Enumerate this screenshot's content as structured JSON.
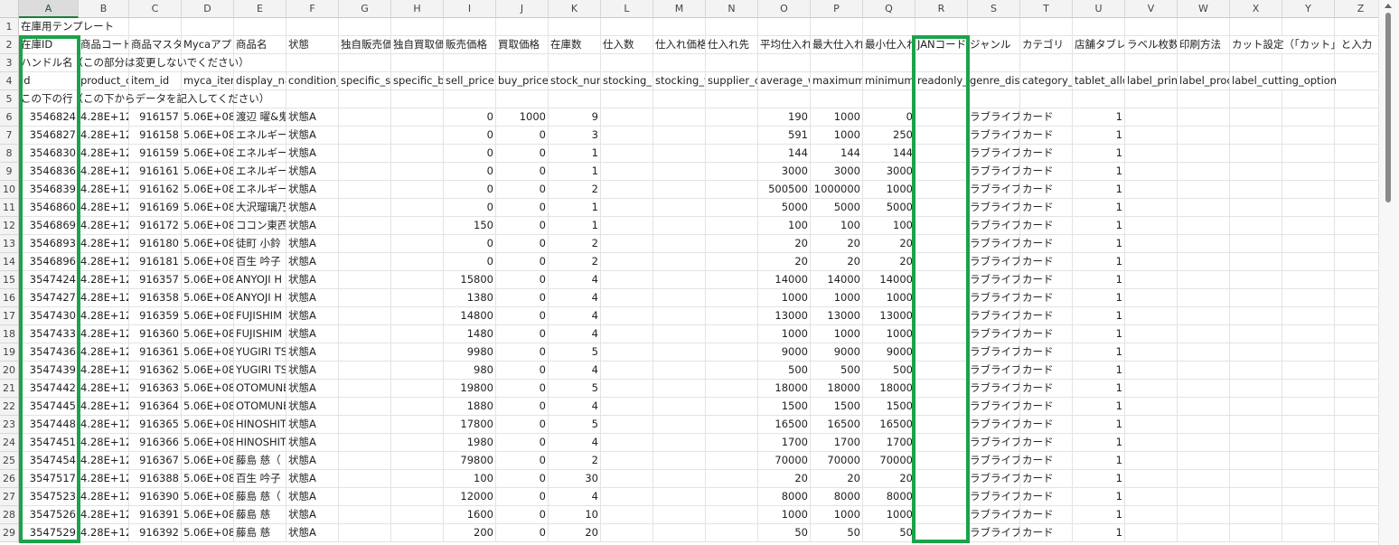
{
  "columns": [
    {
      "letter": "A",
      "w": 66
    },
    {
      "letter": "B",
      "w": 56
    },
    {
      "letter": "C",
      "w": 58
    },
    {
      "letter": "D",
      "w": 58
    },
    {
      "letter": "E",
      "w": 58
    },
    {
      "letter": "F",
      "w": 58
    },
    {
      "letter": "G",
      "w": 58
    },
    {
      "letter": "H",
      "w": 58
    },
    {
      "letter": "I",
      "w": 58
    },
    {
      "letter": "J",
      "w": 58
    },
    {
      "letter": "K",
      "w": 58
    },
    {
      "letter": "L",
      "w": 58
    },
    {
      "letter": "M",
      "w": 58
    },
    {
      "letter": "N",
      "w": 58
    },
    {
      "letter": "O",
      "w": 58
    },
    {
      "letter": "P",
      "w": 58
    },
    {
      "letter": "Q",
      "w": 58
    },
    {
      "letter": "R",
      "w": 58
    },
    {
      "letter": "S",
      "w": 58
    },
    {
      "letter": "T",
      "w": 58
    },
    {
      "letter": "U",
      "w": 58
    },
    {
      "letter": "V",
      "w": 58
    },
    {
      "letter": "W",
      "w": 58
    },
    {
      "letter": "X",
      "w": 58
    },
    {
      "letter": "Y",
      "w": 58
    },
    {
      "letter": "Z",
      "w": 58
    }
  ],
  "header_rows": {
    "row1": "在庫用テンプレート",
    "row2": [
      "在庫ID",
      "商品コード",
      "商品マスタ",
      "Mycaアプ",
      "商品名",
      "状態",
      "独自販売価",
      "独自買取価",
      "販売価格",
      "買取価格",
      "在庫数",
      "仕入数",
      "仕入れ価格",
      "仕入れ先",
      "平均仕入れ",
      "最大仕入れ",
      "最小仕入れ",
      "JANコード",
      "ジャンル",
      "カテゴリ",
      "店舗タブレ",
      "ラベル枚数",
      "印刷方法",
      "カット設定（「カット」と入力"
    ],
    "row3": "ハンドル名（この部分は変更しないでください）",
    "row4": [
      "id",
      "product_c",
      "item_id",
      "myca_item",
      "display_na",
      "condition_",
      "specific_s",
      "specific_b",
      "sell_price",
      "buy_price",
      "stock_num",
      "stocking_i",
      "stocking_v",
      "supplier_c",
      "average_w",
      "maximum_",
      "minimum_",
      "readonly_",
      "genre_dis",
      "category_",
      "tablet_allo",
      "label_prin",
      "label_proc",
      "label_cutting_option"
    ],
    "row5": "この下の行（この下からデータを記入してください）"
  },
  "rows": [
    {
      "n": 6,
      "id": "3546824",
      "b": "4.28E+12",
      "c": "916157",
      "d": "5.06E+08",
      "e": "渡辺 曜&鬼",
      "f": "状態A",
      "sell": "0",
      "buy": "1000",
      "stock": "9",
      "avg": "190",
      "max": "1000",
      "min": "0",
      "genre": "ラブライブ",
      "cat": "カード",
      "tab": "1"
    },
    {
      "n": 7,
      "id": "3546827",
      "b": "4.28E+12",
      "c": "916158",
      "d": "5.06E+08",
      "e": "エネルギー",
      "f": "状態A",
      "sell": "0",
      "buy": "0",
      "stock": "3",
      "avg": "591",
      "max": "1000",
      "min": "250",
      "genre": "ラブライブ",
      "cat": "カード",
      "tab": "1"
    },
    {
      "n": 8,
      "id": "3546830",
      "b": "4.28E+12",
      "c": "916159",
      "d": "5.06E+08",
      "e": "エネルギー",
      "f": "状態A",
      "sell": "0",
      "buy": "0",
      "stock": "1",
      "avg": "144",
      "max": "144",
      "min": "144",
      "genre": "ラブライブ",
      "cat": "カード",
      "tab": "1"
    },
    {
      "n": 9,
      "id": "3546836",
      "b": "4.28E+12",
      "c": "916161",
      "d": "5.06E+08",
      "e": "エネルギー",
      "f": "状態A",
      "sell": "0",
      "buy": "0",
      "stock": "1",
      "avg": "3000",
      "max": "3000",
      "min": "3000",
      "genre": "ラブライブ",
      "cat": "カード",
      "tab": "1"
    },
    {
      "n": 10,
      "id": "3546839",
      "b": "4.28E+12",
      "c": "916162",
      "d": "5.06E+08",
      "e": "エネルギー",
      "f": "状態A",
      "sell": "0",
      "buy": "0",
      "stock": "2",
      "avg": "500500",
      "max": "1000000",
      "min": "1000",
      "genre": "ラブライブ",
      "cat": "カード",
      "tab": "1"
    },
    {
      "n": 11,
      "id": "3546860",
      "b": "4.28E+12",
      "c": "916169",
      "d": "5.06E+08",
      "e": "大沢瑠璃乃",
      "f": "状態A",
      "sell": "0",
      "buy": "0",
      "stock": "1",
      "avg": "5000",
      "max": "5000",
      "min": "5000",
      "genre": "ラブライブ",
      "cat": "カード",
      "tab": "1"
    },
    {
      "n": 12,
      "id": "3546869",
      "b": "4.28E+12",
      "c": "916172",
      "d": "5.06E+08",
      "e": "ココン東西",
      "f": "状態A",
      "sell": "150",
      "buy": "0",
      "stock": "1",
      "avg": "100",
      "max": "100",
      "min": "100",
      "genre": "ラブライブ",
      "cat": "カード",
      "tab": "1"
    },
    {
      "n": 13,
      "id": "3546893",
      "b": "4.28E+12",
      "c": "916180",
      "d": "5.06E+08",
      "e": "徒町 小鈴",
      "f": "状態A",
      "sell": "0",
      "buy": "0",
      "stock": "2",
      "avg": "20",
      "max": "20",
      "min": "20",
      "genre": "ラブライブ",
      "cat": "カード",
      "tab": "1"
    },
    {
      "n": 14,
      "id": "3546896",
      "b": "4.28E+12",
      "c": "916181",
      "d": "5.06E+08",
      "e": "百生 吟子",
      "f": "状態A",
      "sell": "0",
      "buy": "0",
      "stock": "2",
      "avg": "20",
      "max": "20",
      "min": "20",
      "genre": "ラブライブ",
      "cat": "カード",
      "tab": "1"
    },
    {
      "n": 15,
      "id": "3547424",
      "b": "4.28E+12",
      "c": "916357",
      "d": "5.06E+08",
      "e": "ANYOJI H",
      "f": "状態A",
      "sell": "15800",
      "buy": "0",
      "stock": "4",
      "avg": "14000",
      "max": "14000",
      "min": "14000",
      "genre": "ラブライブ",
      "cat": "カード",
      "tab": "1"
    },
    {
      "n": 16,
      "id": "3547427",
      "b": "4.28E+12",
      "c": "916358",
      "d": "5.06E+08",
      "e": "ANYOJI H",
      "f": "状態A",
      "sell": "1380",
      "buy": "0",
      "stock": "4",
      "avg": "1000",
      "max": "1000",
      "min": "1000",
      "genre": "ラブライブ",
      "cat": "カード",
      "tab": "1"
    },
    {
      "n": 17,
      "id": "3547430",
      "b": "4.28E+12",
      "c": "916359",
      "d": "5.06E+08",
      "e": "FUJISHIM",
      "f": "状態A",
      "sell": "14800",
      "buy": "0",
      "stock": "4",
      "avg": "13000",
      "max": "13000",
      "min": "13000",
      "genre": "ラブライブ",
      "cat": "カード",
      "tab": "1"
    },
    {
      "n": 18,
      "id": "3547433",
      "b": "4.28E+12",
      "c": "916360",
      "d": "5.06E+08",
      "e": "FUJISHIM",
      "f": "状態A",
      "sell": "1480",
      "buy": "0",
      "stock": "4",
      "avg": "1000",
      "max": "1000",
      "min": "1000",
      "genre": "ラブライブ",
      "cat": "カード",
      "tab": "1"
    },
    {
      "n": 19,
      "id": "3547436",
      "b": "4.28E+12",
      "c": "916361",
      "d": "5.06E+08",
      "e": "YUGIRI TS",
      "f": "状態A",
      "sell": "9980",
      "buy": "0",
      "stock": "5",
      "avg": "9000",
      "max": "9000",
      "min": "9000",
      "genre": "ラブライブ",
      "cat": "カード",
      "tab": "1"
    },
    {
      "n": 20,
      "id": "3547439",
      "b": "4.28E+12",
      "c": "916362",
      "d": "5.06E+08",
      "e": "YUGIRI TS",
      "f": "状態A",
      "sell": "980",
      "buy": "0",
      "stock": "4",
      "avg": "500",
      "max": "500",
      "min": "500",
      "genre": "ラブライブ",
      "cat": "カード",
      "tab": "1"
    },
    {
      "n": 21,
      "id": "3547442",
      "b": "4.28E+12",
      "c": "916363",
      "d": "5.06E+08",
      "e": "OTOMUNE",
      "f": "状態A",
      "sell": "19800",
      "buy": "0",
      "stock": "5",
      "avg": "18000",
      "max": "18000",
      "min": "18000",
      "genre": "ラブライブ",
      "cat": "カード",
      "tab": "1"
    },
    {
      "n": 22,
      "id": "3547445",
      "b": "4.28E+12",
      "c": "916364",
      "d": "5.06E+08",
      "e": "OTOMUNE",
      "f": "状態A",
      "sell": "1880",
      "buy": "0",
      "stock": "4",
      "avg": "1500",
      "max": "1500",
      "min": "1500",
      "genre": "ラブライブ",
      "cat": "カード",
      "tab": "1"
    },
    {
      "n": 23,
      "id": "3547448",
      "b": "4.28E+12",
      "c": "916365",
      "d": "5.06E+08",
      "e": "HINOSHIT",
      "f": "状態A",
      "sell": "17800",
      "buy": "0",
      "stock": "5",
      "avg": "16500",
      "max": "16500",
      "min": "16500",
      "genre": "ラブライブ",
      "cat": "カード",
      "tab": "1"
    },
    {
      "n": 24,
      "id": "3547451",
      "b": "4.28E+12",
      "c": "916366",
      "d": "5.06E+08",
      "e": "HINOSHIT",
      "f": "状態A",
      "sell": "1980",
      "buy": "0",
      "stock": "4",
      "avg": "1700",
      "max": "1700",
      "min": "1700",
      "genre": "ラブライブ",
      "cat": "カード",
      "tab": "1"
    },
    {
      "n": 25,
      "id": "3547454",
      "b": "4.28E+12",
      "c": "916367",
      "d": "5.06E+08",
      "e": "藤島 慈（",
      "f": "状態A",
      "sell": "79800",
      "buy": "0",
      "stock": "2",
      "avg": "70000",
      "max": "70000",
      "min": "70000",
      "genre": "ラブライブ",
      "cat": "カード",
      "tab": "1"
    },
    {
      "n": 26,
      "id": "3547517",
      "b": "4.28E+12",
      "c": "916388",
      "d": "5.06E+08",
      "e": "百生 吟子",
      "f": "状態A",
      "sell": "100",
      "buy": "0",
      "stock": "30",
      "avg": "20",
      "max": "20",
      "min": "20",
      "genre": "ラブライブ",
      "cat": "カード",
      "tab": "1"
    },
    {
      "n": 27,
      "id": "3547523",
      "b": "4.28E+12",
      "c": "916390",
      "d": "5.06E+08",
      "e": "藤島 慈（",
      "f": "状態A",
      "sell": "12000",
      "buy": "0",
      "stock": "4",
      "avg": "8000",
      "max": "8000",
      "min": "8000",
      "genre": "ラブライブ",
      "cat": "カード",
      "tab": "1"
    },
    {
      "n": 28,
      "id": "3547526",
      "b": "4.28E+12",
      "c": "916391",
      "d": "5.06E+08",
      "e": "藤島 慈",
      "f": "状態A",
      "sell": "1600",
      "buy": "0",
      "stock": "10",
      "avg": "1000",
      "max": "1000",
      "min": "1000",
      "genre": "ラブライブ",
      "cat": "カード",
      "tab": "1"
    },
    {
      "n": 29,
      "id": "3547529",
      "b": "4.28E+12",
      "c": "916392",
      "d": "5.06E+08",
      "e": "藤島 慈",
      "f": "状態A",
      "sell": "200",
      "buy": "0",
      "stock": "20",
      "avg": "50",
      "max": "50",
      "min": "50",
      "genre": "ラブライブ",
      "cat": "カード",
      "tab": "1"
    }
  ]
}
